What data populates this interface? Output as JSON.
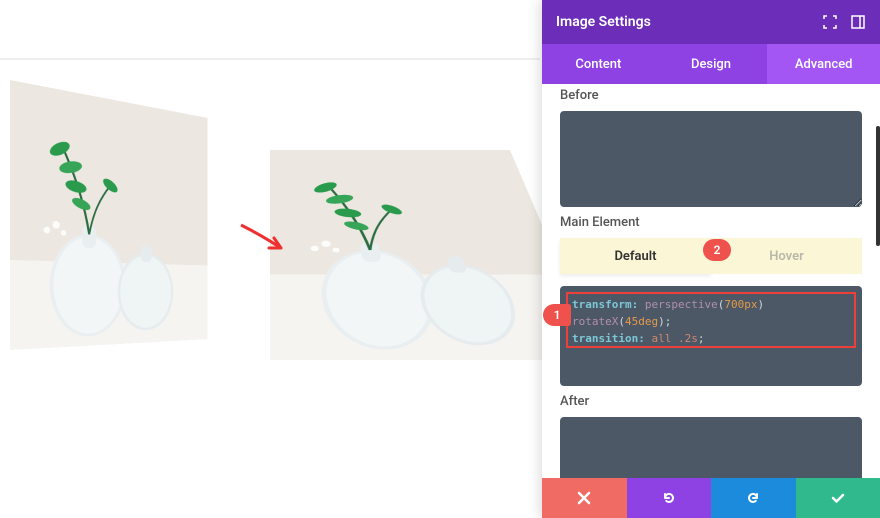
{
  "panel": {
    "title": "Image Settings",
    "tabs": [
      "Content",
      "Design",
      "Advanced"
    ],
    "active_tab": 2
  },
  "sections": {
    "before_label": "Before",
    "main_label": "Main Element",
    "after_label": "After"
  },
  "subtabs": {
    "default": "Default",
    "hover": "Hover",
    "active": 0
  },
  "code": {
    "line1_prop": "transform:",
    "line1_func": "perspective",
    "line1_arg": "700px",
    "line2_func": "rotateX",
    "line2_arg": "45deg",
    "line3_prop": "transition:",
    "line3_val": "all .2s"
  },
  "callouts": {
    "one": "1",
    "two": "2"
  },
  "colors": {
    "accent": "#8e42e3",
    "danger": "#ef524c",
    "info": "#1d8bdb",
    "success": "#2fb98c"
  }
}
